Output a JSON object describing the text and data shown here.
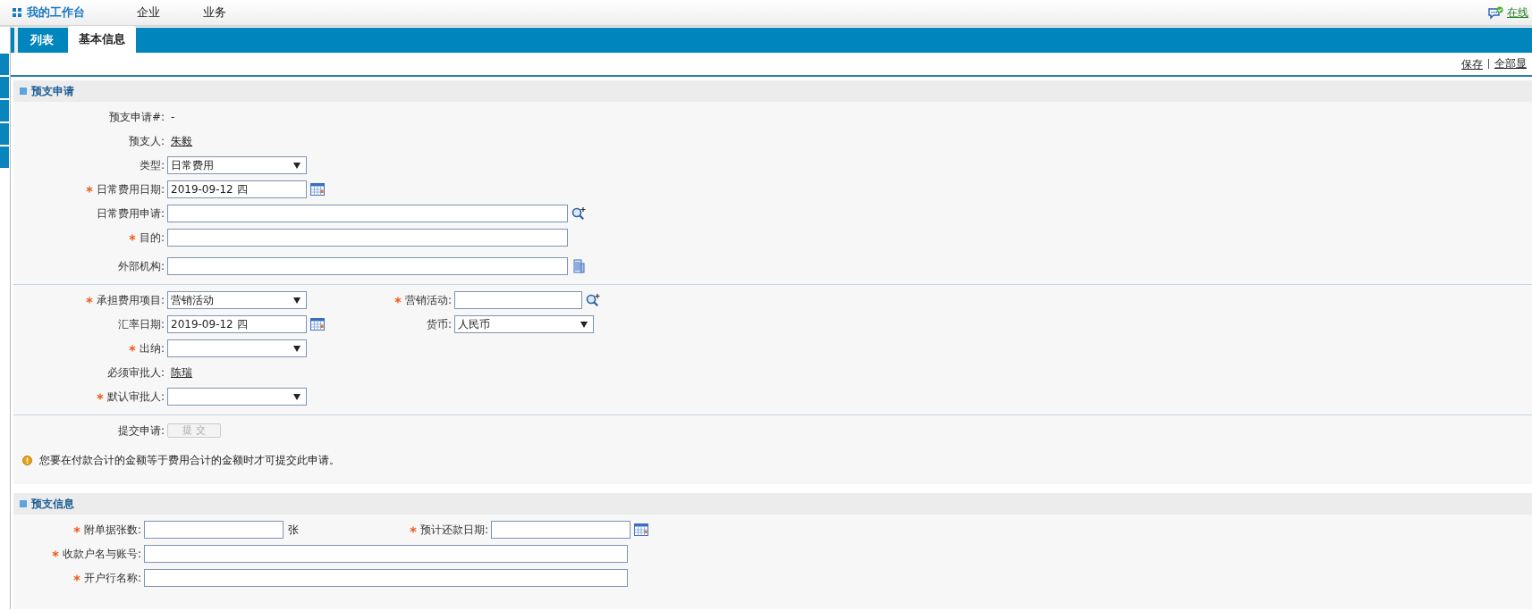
{
  "top_nav": {
    "logo": "我的工作台",
    "items": [
      "企业",
      "业务"
    ],
    "status": "在线"
  },
  "tabs": [
    {
      "label": "列表",
      "selected": false
    },
    {
      "label": "基本信息",
      "selected": true
    }
  ],
  "toolbar": {
    "actions": [
      "保存",
      "全部显"
    ]
  },
  "sections": [
    {
      "title": "预支申请",
      "groups": [
        [
          {
            "fields": [
              {
                "label": "预支申请#:",
                "required": false,
                "kind": "static",
                "value": "-"
              }
            ]
          },
          {
            "fields": [
              {
                "label": "预支人:",
                "required": false,
                "kind": "link",
                "value": "朱毅"
              }
            ]
          },
          {
            "fields": [
              {
                "label": "类型:",
                "required": false,
                "kind": "select",
                "value": "日常费用"
              }
            ]
          },
          {
            "fields": [
              {
                "label": "日常费用日期:",
                "required": true,
                "kind": "date",
                "value": "2019-09-12 四"
              }
            ]
          },
          {
            "fields": [
              {
                "label": "日常费用申请:",
                "required": false,
                "kind": "long-lookup"
              }
            ]
          },
          {
            "fields": [
              {
                "label": "目的:",
                "required": true,
                "kind": "long-input"
              }
            ]
          },
          {
            "fields": [
              {
                "label": "外部机构:",
                "required": false,
                "kind": "long-org"
              }
            ]
          }
        ],
        [
          {
            "fields": [
              {
                "label": "承担费用项目:",
                "required": true,
                "kind": "select",
                "value": "营销活动"
              },
              {
                "label": "营销活动:",
                "required": true,
                "kind": "lookup"
              }
            ]
          },
          {
            "fields": [
              {
                "label": "汇率日期:",
                "required": false,
                "kind": "date",
                "value": "2019-09-12 四"
              },
              {
                "label": "货币:",
                "required": false,
                "kind": "select",
                "value": "人民币"
              }
            ]
          },
          {
            "fields": [
              {
                "label": "出纳:",
                "required": true,
                "kind": "select"
              }
            ]
          },
          {
            "fields": [
              {
                "label": "必须审批人:",
                "required": false,
                "kind": "link",
                "value": "陈瑞"
              }
            ]
          },
          {
            "fields": [
              {
                "label": "默认审批人:",
                "required": true,
                "kind": "select"
              }
            ]
          }
        ],
        [
          {
            "fields": [
              {
                "label": "提交申请:",
                "required": false,
                "kind": "button",
                "value": "提 交",
                "disabled": true
              }
            ]
          }
        ]
      ],
      "note": "您要在付款合计的金额等于费用合计的金额时才可提交此申请。"
    },
    {
      "title": "预支信息",
      "groups": [
        [
          {
            "fields": [
              {
                "label": "附单据张数:",
                "required": true,
                "kind": "count",
                "unit": "张"
              },
              {
                "label": "预计还款日期:",
                "required": true,
                "kind": "date"
              }
            ]
          },
          {
            "fields": [
              {
                "label": "收款户名与账号:",
                "required": true,
                "kind": "long-input"
              }
            ]
          },
          {
            "fields": [
              {
                "label": "开户行名称:",
                "required": true,
                "kind": "long-input"
              }
            ]
          }
        ]
      ]
    }
  ]
}
